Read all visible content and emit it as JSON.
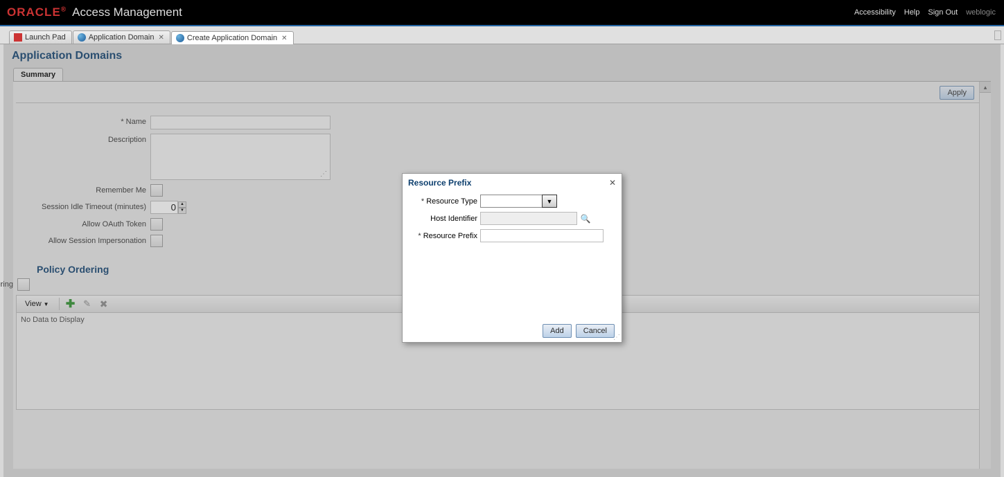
{
  "header": {
    "logo": "ORACLE",
    "logo_r": "®",
    "app_title": "Access Management",
    "links": {
      "accessibility": "Accessibility",
      "help": "Help",
      "signout": "Sign Out"
    },
    "user": "weblogic"
  },
  "tabs": [
    {
      "label": "Launch Pad",
      "closable": false,
      "icon": "red"
    },
    {
      "label": "Application Domain",
      "closable": true,
      "icon": "globe"
    },
    {
      "label": "Create Application Domain",
      "closable": true,
      "icon": "globe",
      "active": true
    }
  ],
  "page": {
    "title": "Application Domains",
    "summary_tab": "Summary",
    "apply": "Apply",
    "fields": {
      "name_label": "Name",
      "name_value": "",
      "description_label": "Description",
      "description_value": "",
      "remember_me_label": "Remember Me",
      "session_idle_label": "Session Idle Timeout (minutes)",
      "session_idle_value": "0",
      "allow_oauth_label": "Allow OAuth Token",
      "allow_imp_label": "Allow Session Impersonation"
    },
    "policy": {
      "title": "Policy Ordering",
      "enable_label": "Enable Policy Ordering",
      "view_label": "View",
      "no_data": "No Data to Display"
    }
  },
  "modal": {
    "title": "Resource Prefix",
    "resource_type_label": "Resource Type",
    "resource_type_value": "",
    "host_identifier_label": "Host Identifier",
    "host_identifier_value": "",
    "resource_prefix_label": "Resource Prefix",
    "resource_prefix_value": "",
    "add": "Add",
    "cancel": "Cancel"
  }
}
